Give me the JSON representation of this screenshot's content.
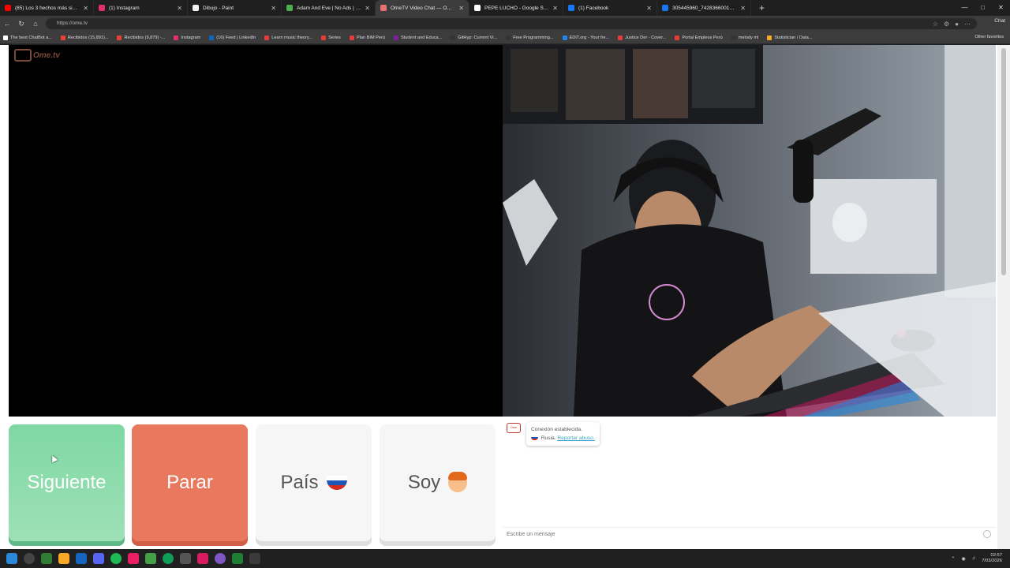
{
  "tabs": [
    {
      "title": "(85) Los 3 hechos más siniestros y",
      "color": "#ff0000"
    },
    {
      "title": "(1) Instagram",
      "color": "#e1306c"
    },
    {
      "title": "Dibujo - Paint",
      "color": "#f2f2f2"
    },
    {
      "title": "Adam And Eve | No Ads | Play At E",
      "color": "#4caf50"
    },
    {
      "title": "OmeTV Video Chat — Omegl",
      "color": "#e57373",
      "active": true
    },
    {
      "title": "PEPE LUCHO - Google Search",
      "color": "#ffffff"
    },
    {
      "title": "(1) Facebook",
      "color": "#1877f2"
    },
    {
      "title": "305445960_742836600122894_50",
      "color": "#1877f2"
    }
  ],
  "address": "https://ome.tv",
  "chat_label": "Chat",
  "bookmarks": [
    {
      "label": "The best ChatBot a...",
      "color": "#ffffff"
    },
    {
      "label": "Recibidos (15,891)...",
      "color": "#ea4335"
    },
    {
      "label": "Recibidos (9,879) -...",
      "color": "#ea4335"
    },
    {
      "label": "Instagram",
      "color": "#e1306c"
    },
    {
      "label": "(16) Feed | LinkedIn",
      "color": "#0a66c2"
    },
    {
      "label": "Learn music theory...",
      "color": "#e53935"
    },
    {
      "label": "Series",
      "color": "#e53935"
    },
    {
      "label": "Plan BIM Perú",
      "color": "#e53935"
    },
    {
      "label": "Student and Educa...",
      "color": "#7b1fa2"
    },
    {
      "label": "GitHyp: Current Vi...",
      "color": "#333333"
    },
    {
      "label": "Free Programming...",
      "color": "#333333"
    },
    {
      "label": "EDIT.org - Your fre...",
      "color": "#1e88e5"
    },
    {
      "label": "Justice Der - Cover...",
      "color": "#e53935"
    },
    {
      "label": "Portal Empleos Perú",
      "color": "#e53935"
    },
    {
      "label": "melody ml",
      "color": "#333333"
    },
    {
      "label": "Statistician / Data...",
      "color": "#f9a825"
    }
  ],
  "other_favorites": "Other favorites",
  "logo_text": "Ome.tv",
  "buttons": {
    "next": "Siguiente",
    "stop": "Parar",
    "country": "País",
    "gender": "Soy"
  },
  "chat": {
    "status": "Conexión establecida.",
    "country": "Rusia.",
    "report": "Reportar abuso.",
    "placeholder": "Escribe un mensaje",
    "logo_mini": "Ome"
  },
  "clock": {
    "time": "02:57",
    "date": "7/03/2026"
  },
  "colors": {
    "next": "#7fd8a3",
    "stop": "#e8795e",
    "neutral": "#f6f6f6",
    "flag": [
      "#ffffff",
      "#1c57b5",
      "#d52b1e"
    ]
  }
}
